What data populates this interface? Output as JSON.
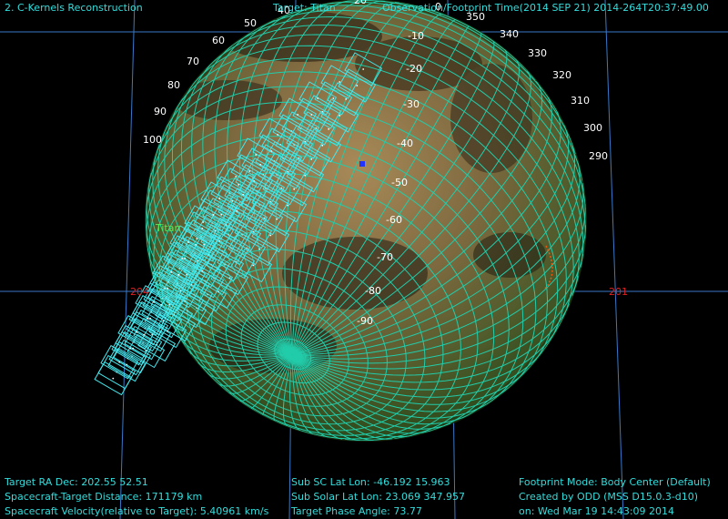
{
  "header": {
    "mode_title": "2. C-Kernels Reconstruction",
    "target_label": "Target: Titan",
    "observation_time": "Observation/Footprint Time(2014 SEP 21) 2014-264T20:37:49.00"
  },
  "body_label": "Titan",
  "colors": {
    "text": "#33dddd",
    "grid": "#22ccaa",
    "footprint": "#44e8ee",
    "ra_dec_grid": "#3a78c8",
    "ra_label": "#dd2222",
    "terminator": "#ee5511",
    "background": "#000000"
  },
  "longitude_labels": [
    "350",
    "340",
    "330",
    "320",
    "310",
    "300",
    "290",
    "40",
    "50",
    "60",
    "70",
    "80",
    "90",
    "100",
    "20",
    "0"
  ],
  "latitude_labels": [
    "-10",
    "-20",
    "-30",
    "-40",
    "-50",
    "-60",
    "-70",
    "-80",
    "-90"
  ],
  "ra_labels": [
    "204",
    "201"
  ],
  "info_left": {
    "ra_dec": "Target RA Dec: 202.55  52.51",
    "distance": "Spacecraft-Target Distance:  171179 km",
    "velocity": "Spacecraft Velocity(relative to Target): 5.40961 km/s"
  },
  "info_middle": {
    "sub_sc": "Sub SC Lat Lon: -46.192  15.963",
    "sub_solar": "Sub Solar Lat Lon: 23.069  347.957",
    "phase": "Target Phase Angle: 73.77"
  },
  "info_right": {
    "footprint_mode": "Footprint Mode: Body Center (Default)",
    "created_by": "Created by ODD (MSS D15.0.3-d10)",
    "created_on": "on: Wed Mar 19 14:43:09 2014"
  }
}
